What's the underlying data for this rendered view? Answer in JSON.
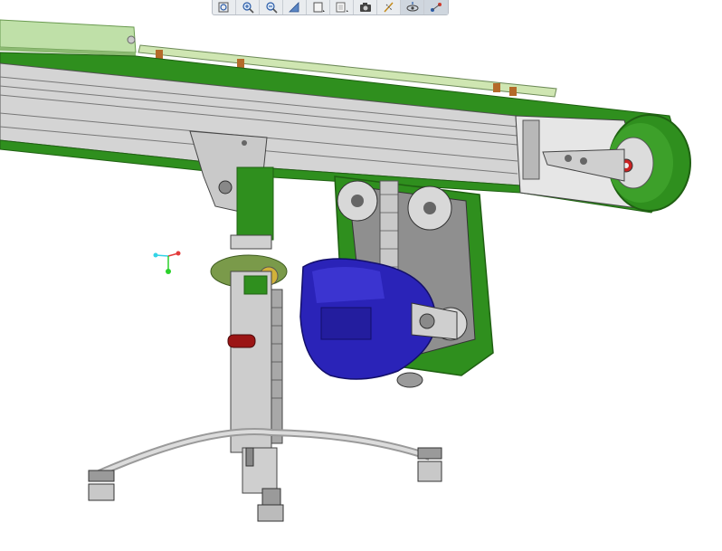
{
  "viewer": {
    "model": "belt-conveyor-assembly",
    "colors": {
      "belt": "#2f8f1e",
      "belt_dark": "#1f6012",
      "frame": "#c9c9c9",
      "motor": "#2a23b8",
      "guide_rail": "#cfe6b2",
      "knob": "#9b1515",
      "compass_x": "#e33a3a",
      "compass_y": "#2bd12b",
      "compass_z": "#33d4e6"
    }
  },
  "toolbar": {
    "buttons": [
      {
        "icon": "zoom-box-icon"
      },
      {
        "icon": "zoom-in-icon"
      },
      {
        "icon": "zoom-out-icon"
      },
      {
        "icon": "view-orientation-icon"
      },
      {
        "icon": "standard-views-icon"
      },
      {
        "icon": "display-style-icon"
      },
      {
        "icon": "camera-icon"
      },
      {
        "icon": "section-view-icon"
      },
      {
        "icon": "hide-show-icon"
      },
      {
        "icon": "pointer-icon"
      }
    ]
  }
}
